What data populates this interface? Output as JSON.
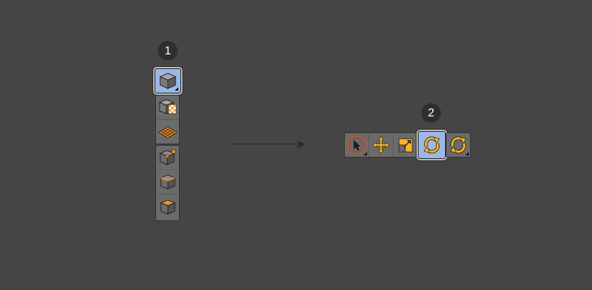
{
  "badges": {
    "first": "1",
    "second": "2"
  },
  "colors": {
    "background": "#454545",
    "panel": "#6b6b6b",
    "selected": "#9bb7e6",
    "accent_orange": "#f0902a",
    "accent_yellow": "#f5b52c"
  },
  "vertical_palette": {
    "selected": {
      "icon": "model-mode-icon",
      "has_submenu": true
    },
    "group_a": [
      {
        "icon": "texture-mode-icon"
      },
      {
        "icon": "workplane-mode-icon"
      }
    ],
    "group_b": [
      {
        "icon": "points-mode-icon"
      },
      {
        "icon": "edges-mode-icon"
      },
      {
        "icon": "polygons-mode-icon"
      }
    ]
  },
  "horizontal_toolbar": {
    "group_a": [
      {
        "icon": "live-selection-icon",
        "has_submenu": true
      },
      {
        "icon": "move-tool-icon"
      },
      {
        "icon": "scale-tool-icon"
      }
    ],
    "selected": {
      "icon": "rotate-tool-icon"
    },
    "group_b": [
      {
        "icon": "recent-tools-rotate-icon",
        "has_submenu": true
      }
    ]
  }
}
